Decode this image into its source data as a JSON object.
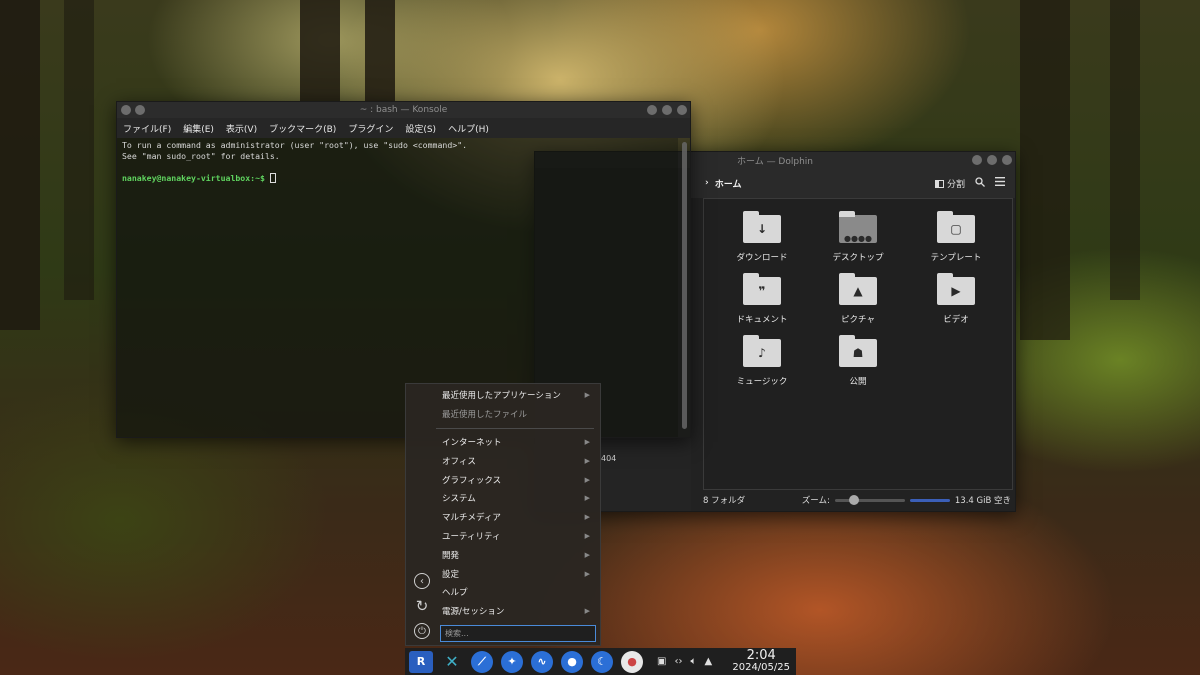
{
  "konsole": {
    "title": "~ : bash — Konsole",
    "menu": [
      "ファイル(F)",
      "編集(E)",
      "表示(V)",
      "ブックマーク(B)",
      "プラグイン",
      "設定(S)",
      "ヘルプ(H)"
    ],
    "lines": [
      "To run a command as administrator (user \"root\"), use \"sudo <command>\".",
      "See \"man sudo_root\" for details."
    ],
    "prompt": "nanakey@nanakey-virtualbox:~$"
  },
  "dolphin": {
    "title": "ホーム — Dolphin",
    "breadcrumb": "ホーム",
    "split_label": "分割",
    "folders": [
      {
        "name": "ダウンロード",
        "icon": "download-icon"
      },
      {
        "name": "デスクトップ",
        "icon": "desktop-icon"
      },
      {
        "name": "テンプレート",
        "icon": "template-icon"
      },
      {
        "name": "ドキュメント",
        "icon": "document-icon"
      },
      {
        "name": "ピクチャ",
        "icon": "picture-icon"
      },
      {
        "name": "ビデオ",
        "icon": "video-icon"
      },
      {
        "name": "ミュージック",
        "icon": "music-icon"
      },
      {
        "name": "公開",
        "icon": "public-icon"
      }
    ],
    "status_count": "8 フォルダ",
    "zoom_label": "ズーム:",
    "free_space": "13.4 GiB 空き",
    "partial_text": "404"
  },
  "launcher": {
    "items": [
      {
        "label": "最近使用したアプリケーション",
        "submenu": true,
        "dim": false
      },
      {
        "label": "最近使用したファイル",
        "submenu": false,
        "dim": true
      },
      {
        "label": "インターネット",
        "submenu": true,
        "dim": false
      },
      {
        "label": "オフィス",
        "submenu": true,
        "dim": false
      },
      {
        "label": "グラフィックス",
        "submenu": true,
        "dim": false
      },
      {
        "label": "システム",
        "submenu": true,
        "dim": false
      },
      {
        "label": "マルチメディア",
        "submenu": true,
        "dim": false
      },
      {
        "label": "ユーティリティ",
        "submenu": true,
        "dim": false
      },
      {
        "label": "開発",
        "submenu": true,
        "dim": false
      },
      {
        "label": "設定",
        "submenu": true,
        "dim": false
      },
      {
        "label": "ヘルプ",
        "submenu": false,
        "dim": false
      },
      {
        "label": "電源/セッション",
        "submenu": true,
        "dim": false
      }
    ],
    "search_placeholder": "検索..."
  },
  "taskbar": {
    "time": "2:04",
    "date": "2024/05/25",
    "colors": {
      "accent": "#4a8ad8",
      "dock_blue": "#2b6fd6"
    }
  }
}
